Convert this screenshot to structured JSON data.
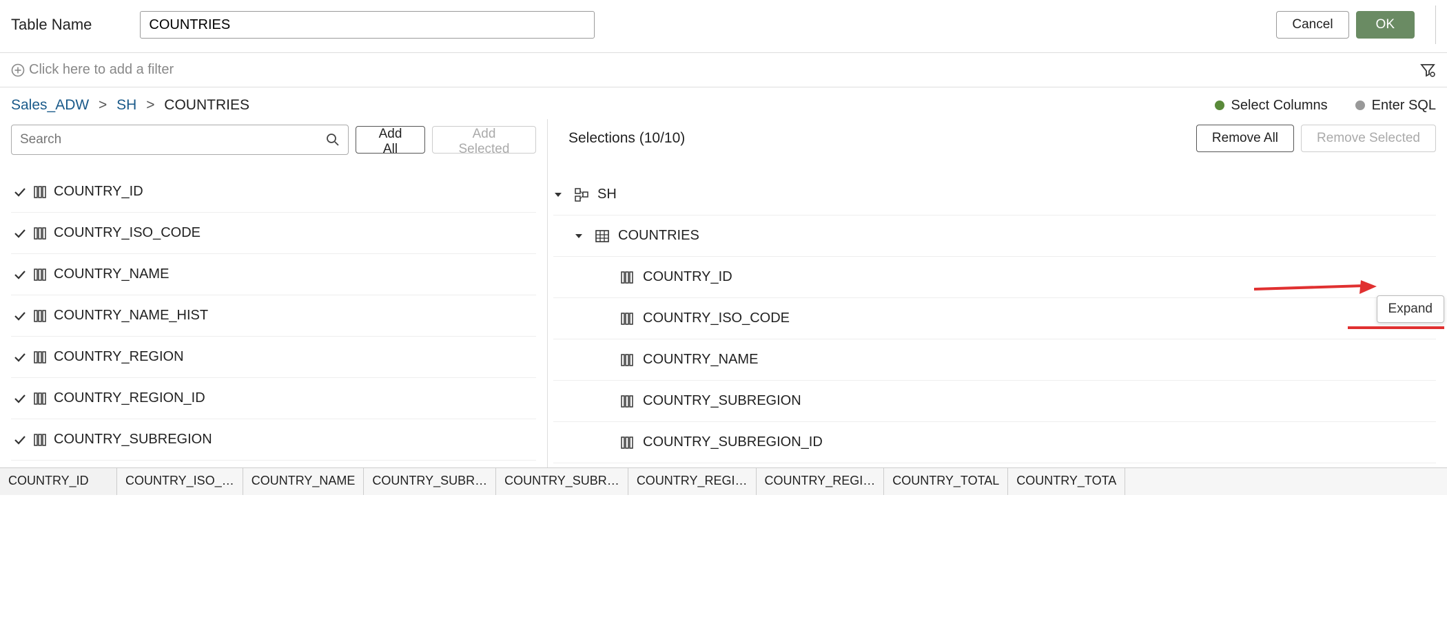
{
  "header": {
    "label": "Table Name",
    "input_value": "COUNTRIES",
    "cancel": "Cancel",
    "ok": "OK"
  },
  "filter": {
    "text": "Click here to add a filter"
  },
  "breadcrumb": {
    "a": "Sales_ADW",
    "b": "SH",
    "c": "COUNTRIES"
  },
  "modes": {
    "select_columns": "Select Columns",
    "enter_sql": "Enter SQL"
  },
  "left": {
    "search_placeholder": "Search",
    "add_all": "Add All",
    "add_selected": "Add Selected",
    "columns": [
      "COUNTRY_ID",
      "COUNTRY_ISO_CODE",
      "COUNTRY_NAME",
      "COUNTRY_NAME_HIST",
      "COUNTRY_REGION",
      "COUNTRY_REGION_ID",
      "COUNTRY_SUBREGION"
    ]
  },
  "right": {
    "title": "Selections (10/10)",
    "remove_all": "Remove All",
    "remove_selected": "Remove Selected",
    "schema": "SH",
    "table": "COUNTRIES",
    "columns": [
      "COUNTRY_ID",
      "COUNTRY_ISO_CODE",
      "COUNTRY_NAME",
      "COUNTRY_SUBREGION",
      "COUNTRY_SUBREGION_ID"
    ],
    "tooltip": "Expand"
  },
  "tabs": [
    "COUNTRY_ID",
    "COUNTRY_ISO_…",
    "COUNTRY_NAME",
    "COUNTRY_SUBR…",
    "COUNTRY_SUBR…",
    "COUNTRY_REGI…",
    "COUNTRY_REGI…",
    "COUNTRY_TOTAL",
    "COUNTRY_TOTA"
  ]
}
